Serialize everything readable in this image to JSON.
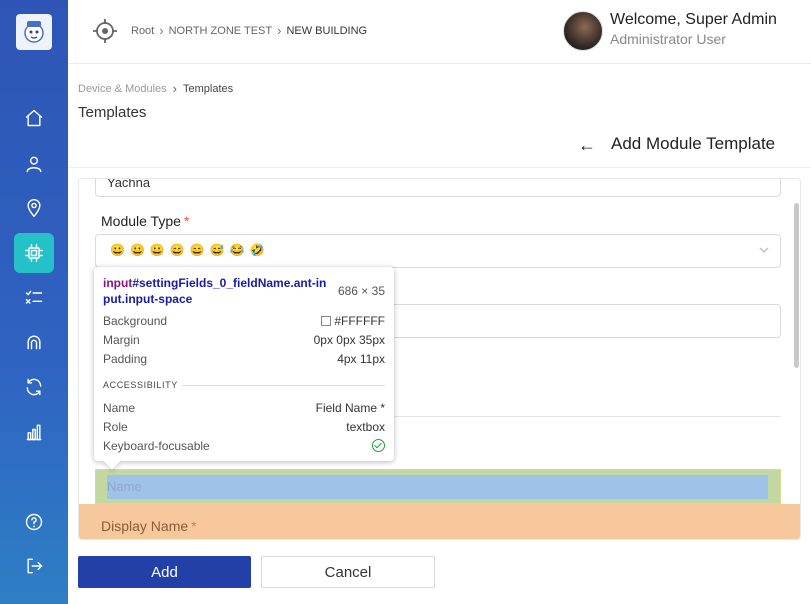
{
  "topbar": {
    "breadcrumb": [
      "Root",
      "NORTH ZONE TEST",
      "NEW BUILDING"
    ],
    "welcome": "Welcome, Super Admin",
    "role": "Administrator User"
  },
  "sidebar": {
    "items": [
      {
        "icon": "home-icon"
      },
      {
        "icon": "user-icon"
      },
      {
        "icon": "location-pin-icon"
      },
      {
        "icon": "chip-icon",
        "active": true
      },
      {
        "icon": "checklist-icon"
      },
      {
        "icon": "signal-icon"
      },
      {
        "icon": "sync-icon"
      },
      {
        "icon": "bar-chart-icon"
      },
      {
        "icon": "help-icon"
      },
      {
        "icon": "logout-icon"
      }
    ]
  },
  "page": {
    "breadcrumb": [
      "Device & Modules",
      "Templates"
    ],
    "title": "Templates",
    "form_title": "Add Module Template"
  },
  "form": {
    "top_input_value": "Yachna",
    "module_type_label": "Module Type",
    "module_type_emojis": "😀😀😀😄😄😅😂🤣",
    "name_placeholder": "Name",
    "display_name_label": "Display Name",
    "required_mark": "*"
  },
  "tooltip": {
    "selector_tag": "input",
    "selector_rest": "#settingFields_0_fieldName.ant-input.input-space",
    "size": "686 × 35",
    "background_label": "Background",
    "background_value": "#FFFFFF",
    "margin_label": "Margin",
    "margin_value": "0px 0px 35px",
    "padding_label": "Padding",
    "padding_value": "4px 11px",
    "section": "ACCESSIBILITY",
    "name_label": "Name",
    "name_value": "Field Name *",
    "role_label": "Role",
    "role_value": "textbox",
    "focus_label": "Keyboard-focusable"
  },
  "buttons": {
    "add": "Add",
    "cancel": "Cancel"
  },
  "colors": {
    "sidebar": "#2e55b5",
    "active": "#25c1c9",
    "primary_button": "#233fa8"
  }
}
